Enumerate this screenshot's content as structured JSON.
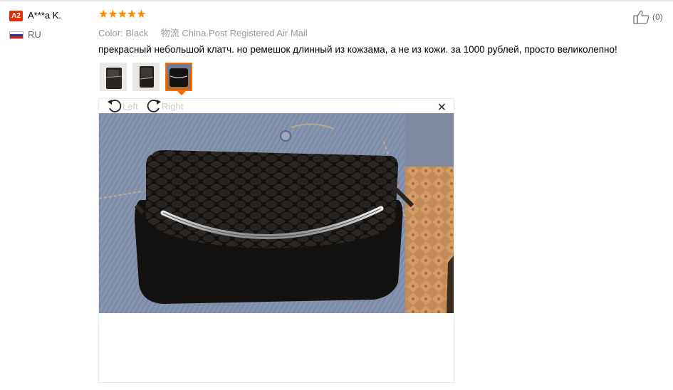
{
  "reviewer": {
    "badge": "A2",
    "name": "A***a K.",
    "country": "RU",
    "flag_colors": [
      "#ffffff",
      "#1c3f94",
      "#e4181c"
    ]
  },
  "review": {
    "rating": 5,
    "stars_text": "★★★★★",
    "star_color": "#ff8a00",
    "color_label": "Color:",
    "color_value": "Black",
    "shipping_label": "物流",
    "shipping_value": "China Post Registered Air Mail",
    "feedback": "прекрасный небольшой клатч. но ремешок длинный из кожзама, а не из кожи. за 1000 рублей, просто великолепно!",
    "helpful_count": "(0)"
  },
  "thumbnails": [
    {
      "name": "clutch-photo-1",
      "selected": false
    },
    {
      "name": "clutch-photo-2",
      "selected": false
    },
    {
      "name": "clutch-photo-3",
      "selected": true
    }
  ],
  "viewer": {
    "rotate_left_label": "Left",
    "rotate_right_label": "Right",
    "close_glyph": "✕"
  },
  "icons": {
    "like": "thumbs-up-icon",
    "rotate_left": "rotate-left-icon",
    "rotate_right": "rotate-right-icon",
    "close": "close-icon"
  },
  "colors": {
    "accent": "#ff6a00",
    "badge": "#e62e04"
  }
}
